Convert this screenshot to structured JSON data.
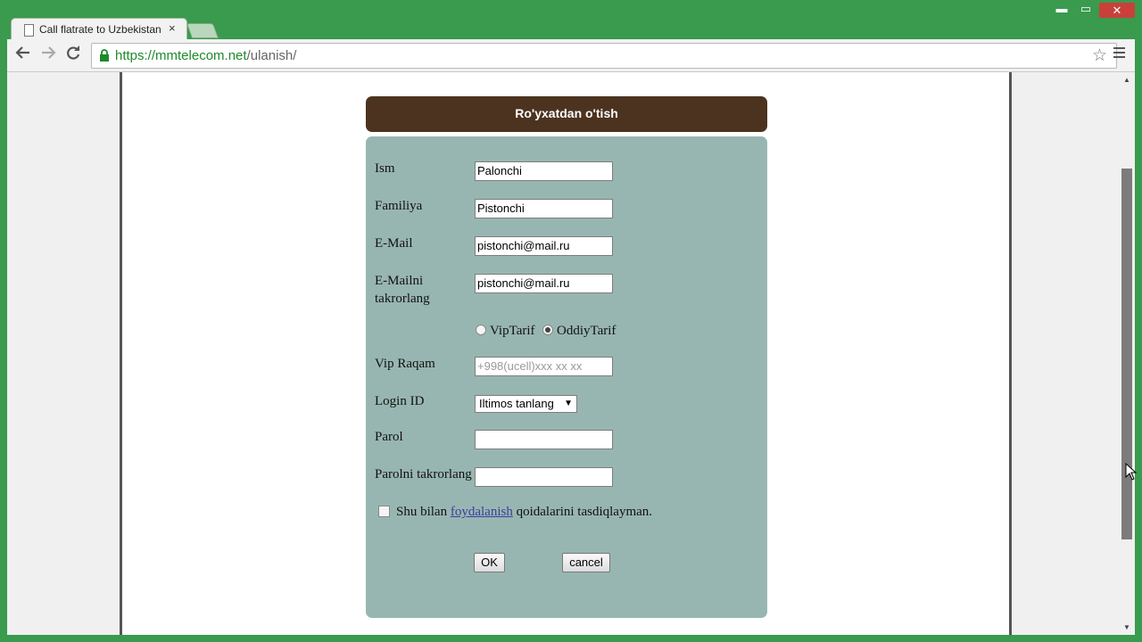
{
  "browser": {
    "tab_title": "Call flatrate to Uzbekistan",
    "tab_close": "×",
    "window_controls": {
      "minimize": "▬",
      "maximize": "▭",
      "close": "✕"
    },
    "url_host": "https://mmtelecom.net",
    "url_path": "/ulanish/",
    "icons": [
      "back-icon",
      "forward-icon",
      "reload-icon",
      "lock-icon",
      "star-icon",
      "menu-icon"
    ]
  },
  "form": {
    "title": "Ro'yxatdan o'tish",
    "fields": {
      "ism": {
        "label": "Ism",
        "value": "Palonchi"
      },
      "familiya": {
        "label": "Familiya",
        "value": "Pistonchi"
      },
      "email": {
        "label": "E-Mail",
        "value": "pistonchi@mail.ru"
      },
      "email_repeat": {
        "label": "E-Mailni takrorlang",
        "value": "pistonchi@mail.ru"
      },
      "vip_raqam": {
        "label": "Vip Raqam",
        "value": "",
        "placeholder": "+998(ucell)xxx xx xx"
      },
      "login_id": {
        "label": "Login ID",
        "selected": "Iltimos tanlang"
      },
      "parol": {
        "label": "Parol",
        "value": ""
      },
      "parol_repeat": {
        "label": "Parolni takrorlang",
        "value": ""
      }
    },
    "tariff": {
      "options": [
        "VipTarif",
        "OddiyTarif"
      ],
      "selected": "OddiyTarif"
    },
    "terms": {
      "prefix": "Shu bilan",
      "link": "foydalanish",
      "suffix": "qoidalarini tasdiqlayman.",
      "checked": false
    },
    "buttons": {
      "ok": "OK",
      "cancel": "cancel"
    }
  },
  "colors": {
    "frame": "#3a9a4e",
    "header_bg": "#4b3320",
    "panel_bg": "#98b6b1"
  }
}
